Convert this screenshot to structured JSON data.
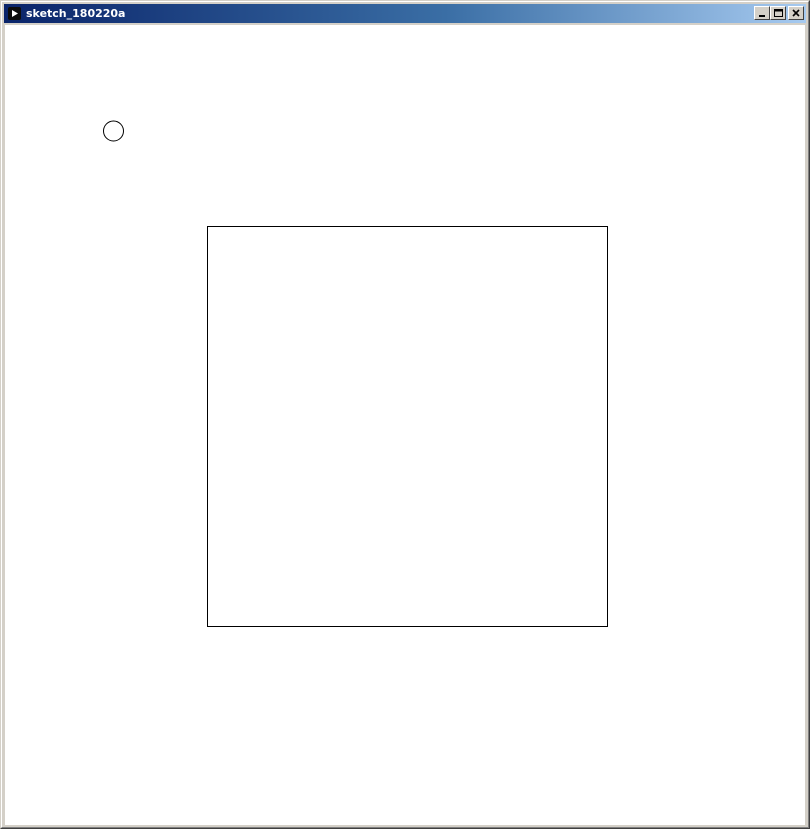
{
  "window": {
    "title": "sketch_180220a",
    "controls": {
      "minimize": "minimize-icon",
      "maximize": "maximize-icon",
      "close": "close-icon"
    }
  },
  "colors": {
    "titlebar_start": "#0a246a",
    "titlebar_end": "#a6caf0",
    "canvas_background": "#ffffff",
    "stroke": "#000000"
  }
}
